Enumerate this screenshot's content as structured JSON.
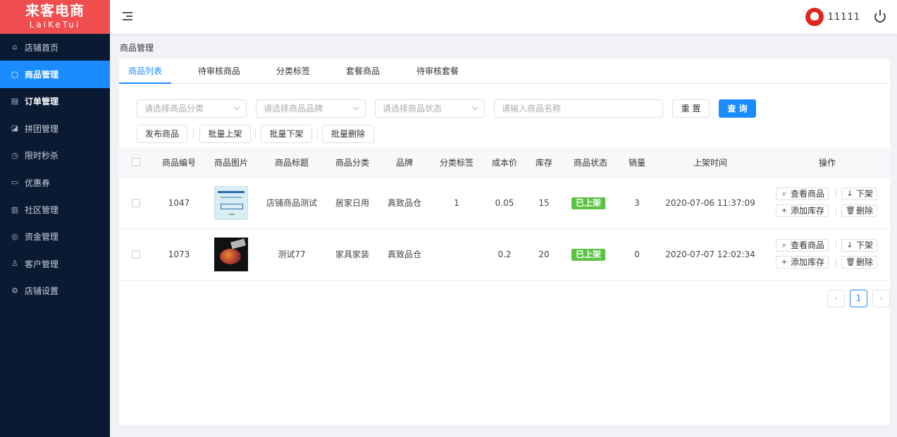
{
  "brand": {
    "title": "来客电商",
    "subtitle": "LaiKeTui"
  },
  "sidebar": {
    "items": [
      {
        "label": "店铺首页",
        "icon": "home-icon"
      },
      {
        "label": "商品管理",
        "icon": "bag-icon",
        "active": true
      },
      {
        "label": "订单管理",
        "icon": "order-icon"
      },
      {
        "label": "拼团管理",
        "icon": "group-icon"
      },
      {
        "label": "限时秒杀",
        "icon": "clock-icon"
      },
      {
        "label": "优惠券",
        "icon": "coupon-icon"
      },
      {
        "label": "社区管理",
        "icon": "building-icon"
      },
      {
        "label": "资金管理",
        "icon": "money-icon"
      },
      {
        "label": "客户管理",
        "icon": "user-icon"
      },
      {
        "label": "店铺设置",
        "icon": "gear-icon"
      }
    ]
  },
  "header": {
    "username": "11111"
  },
  "breadcrumb": "商品管理",
  "tabs": [
    "商品列表",
    "待审核商品",
    "分类标签",
    "套餐商品",
    "待审核套餐"
  ],
  "filters": {
    "category_placeholder": "请选择商品分类",
    "brand_placeholder": "请选择商品品牌",
    "status_placeholder": "请选择商品状态",
    "name_placeholder": "请输入商品名称",
    "reset_label": "重 置",
    "query_label": "查 询"
  },
  "actions": {
    "publish": "发布商品",
    "batch_on": "批量上架",
    "batch_off": "批量下架",
    "batch_delete": "批量删除"
  },
  "table": {
    "headers": [
      "商品编号",
      "商品图片",
      "商品标题",
      "商品分类",
      "品牌",
      "分类标签",
      "成本价",
      "库存",
      "商品状态",
      "销量",
      "上架时间",
      "操作"
    ],
    "rows": [
      {
        "id": "1047",
        "title": "店铺商品测试",
        "category": "居家日用",
        "brand": "真致品仓",
        "tag": "1",
        "cost": "0.05",
        "stock": "15",
        "status": "已上架",
        "sales": "3",
        "time": "2020-07-06 11:37:09"
      },
      {
        "id": "1073",
        "title": "测试77",
        "category": "家具家装",
        "brand": "真致品仓",
        "tag": "",
        "cost": "0.2",
        "stock": "20",
        "status": "已上架",
        "sales": "0",
        "time": "2020-07-07 12:02:34"
      }
    ],
    "row_actions": {
      "view": "查看商品",
      "off": "下架",
      "add_stock": "添加库存",
      "delete": "删除"
    }
  },
  "pagination": {
    "prev": "‹",
    "current": "1",
    "next": "›"
  },
  "colors": {
    "accent": "#1a8cff",
    "sidebar_bg": "#0b1a33",
    "logo_bg": "#f04e4e",
    "status_green": "#5cc242"
  }
}
